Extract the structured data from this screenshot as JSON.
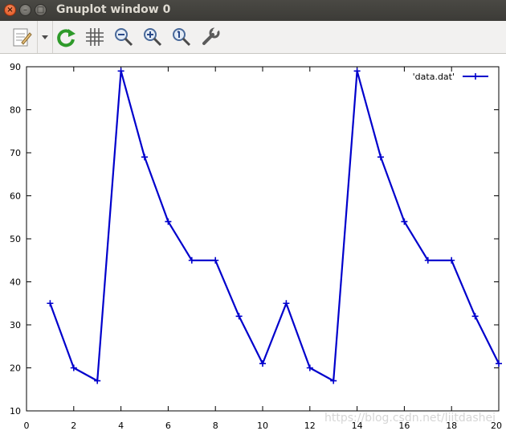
{
  "window": {
    "title": "Gnuplot window 0",
    "close_glyph": "×",
    "minimize_glyph": "–",
    "maximize_glyph": "□"
  },
  "toolbar": {
    "buttons": [
      "copy-to-clipboard",
      "dropdown",
      "replot",
      "grid",
      "zoom-previous",
      "zoom-next",
      "zoom-reset",
      "options"
    ]
  },
  "chart_data": {
    "type": "line",
    "series": [
      {
        "name": "'data.dat'",
        "x": [
          1,
          2,
          3,
          4,
          5,
          6,
          7,
          8,
          9,
          10,
          11,
          12,
          13,
          14,
          15,
          16,
          17,
          18,
          19,
          20
        ],
        "y": [
          35,
          20,
          17,
          89,
          69,
          54,
          45,
          45,
          32,
          21,
          35,
          20,
          17,
          89,
          69,
          54,
          45,
          45,
          32,
          21
        ],
        "color": "#0000cc",
        "marker": "plus"
      }
    ],
    "xlim": [
      0,
      20
    ],
    "ylim": [
      10,
      90
    ],
    "xticks": [
      "0",
      "2",
      "4",
      "6",
      "8",
      "10",
      "12",
      "14",
      "16",
      "18",
      "20"
    ],
    "yticks": [
      "10",
      "20",
      "30",
      "40",
      "50",
      "60",
      "70",
      "80",
      "90"
    ],
    "legend": "top-right",
    "grid": false
  },
  "watermark": "https://blog.csdn.net/liitdashei"
}
